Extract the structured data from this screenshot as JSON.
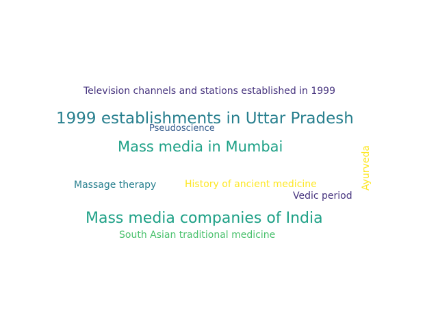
{
  "words": {
    "w1": "Television channels and stations established in 1999",
    "w2": "1999 establishments in Uttar Pradesh",
    "w3": "Pseudoscience",
    "w4": "Mass media in Mumbai",
    "w5": "Massage therapy",
    "w6": "History of ancient medicine",
    "w7": "Vedic period",
    "w8": "Mass media companies of India",
    "w9": "South Asian traditional medicine",
    "w10": "Ayurveda"
  },
  "colors": {
    "dark_purple": "#46337e",
    "steel_blue": "#365c8d",
    "teal": "#277f8e",
    "green": "#1fa187",
    "light_green": "#4ac16d",
    "yellow": "#fde725"
  }
}
